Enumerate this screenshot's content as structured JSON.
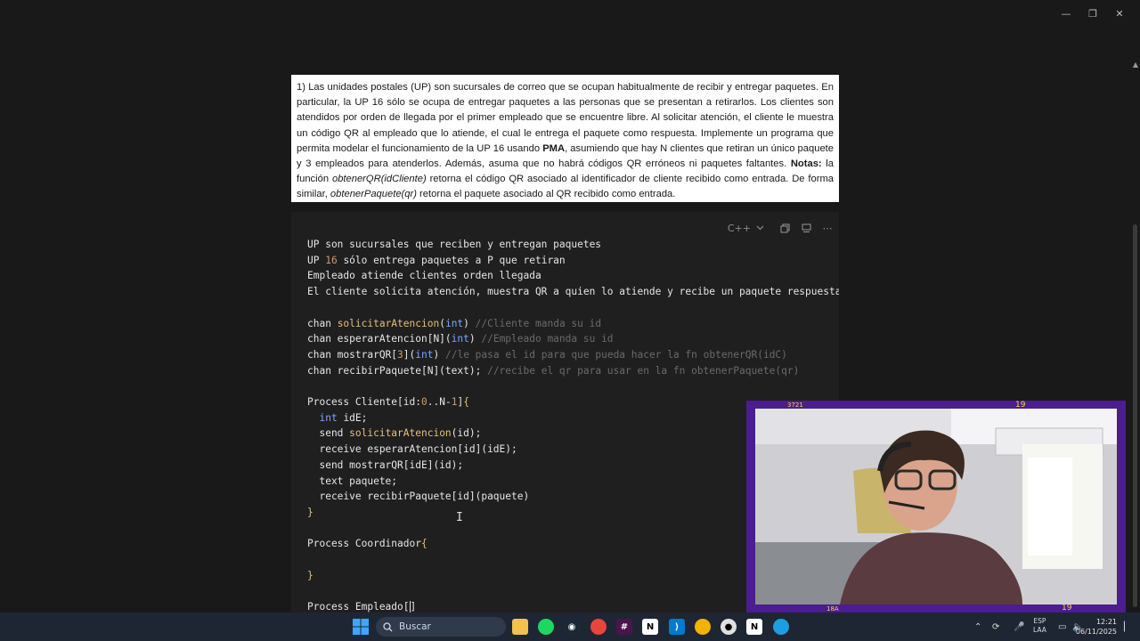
{
  "window": {
    "minimize": "—",
    "restore": "❐",
    "close": "✕"
  },
  "problem": {
    "p1": "1) Las unidades postales (UP) son sucursales de correo que se ocupan habitualmente de recibir y entregar paquetes. En particular, la UP 16 sólo se ocupa de entregar paquetes a las personas que se presentan a retirarlos.  Los clientes son atendidos por orden de llegada por el primer empleado que se encuentre libre.  Al solicitar atención, el cliente le muestra un código QR al empleado que lo atiende, el cual le entrega el paquete como respuesta. Implemente un programa que permita modelar el funcionamiento de la UP 16 usando ",
    "pma": "PMA",
    "p2": ", asumiendo que hay N clientes que retiran un único paquete y 3 empleados para atenderlos. Además, asuma que no habrá códigos QR erróneos ni paquetes faltantes. ",
    "notas": "Notas:",
    "p3": " la función ",
    "fn1": "obtenerQR(idCliente)",
    "p4": " retorna el código QR asociado al identificador de cliente recibido como entrada. De forma similar, ",
    "fn2": "obtenerPaquete(qr)",
    "p5": " retorna el paquete asociado al QR recibido como entrada."
  },
  "code": {
    "language": "C++",
    "lines": {
      "l1": "UP son sucursales que reciben y entregan paquetes",
      "l2a": "UP ",
      "l2b": "16",
      "l2c": " sólo entrega paquetes a P que retiran",
      "l3": "Empleado atiende clientes orden llegada",
      "l4": "El cliente solicita atención, muestra QR a quien lo atiende y recibe un paquete respuesta",
      "l6a": "chan ",
      "l6b": "solicitarAtencion",
      "l6c": "(",
      "l6d": "int",
      "l6e": ") ",
      "l6f": "//Cliente manda su id",
      "l7a": "chan esperarAtencion[N](",
      "l7b": "int",
      "l7c": ") ",
      "l7d": "//Empleado manda su id",
      "l8a": "chan mostrarQR[",
      "l8b": "3",
      "l8c": "](",
      "l8d": "int",
      "l8e": ") ",
      "l8f": "//le pasa el id para que pueda hacer la fn obtenerQR(idC)",
      "l9a": "chan recibirPaquete[N](text); ",
      "l9b": "//recibe el qr para usar en la fn obtenerPaquete(qr)",
      "l11a": "Process Cliente[id:",
      "l11b": "0",
      "l11c": "..N-",
      "l11d": "1",
      "l11e": "]",
      "l11f": "{",
      "l12a": "  ",
      "l12b": "int",
      "l12c": " idE;",
      "l13a": "  send ",
      "l13b": "solicitarAtencion",
      "l13c": "(id);",
      "l14": "  receive esperarAtencion[id](idE);",
      "l15": "  send mostrarQR[idE](id);",
      "l16": "  text paquete;",
      "l17": "  receive recibirPaquete[id](paquete)",
      "l18": "}",
      "l20a": "Process Coordinador",
      "l20b": "{",
      "l22": "}",
      "l24a": "Process Empleado[",
      "l24b": "]"
    }
  },
  "webcam": {
    "top_left": "3721",
    "top_right": "19",
    "bottom_left": "18A",
    "bottom_right": "19"
  },
  "taskbar": {
    "search_placeholder": "Buscar",
    "lang_top": "ESP",
    "lang_bottom": "LAA",
    "time": "12:21",
    "date": "06/11/2025"
  }
}
